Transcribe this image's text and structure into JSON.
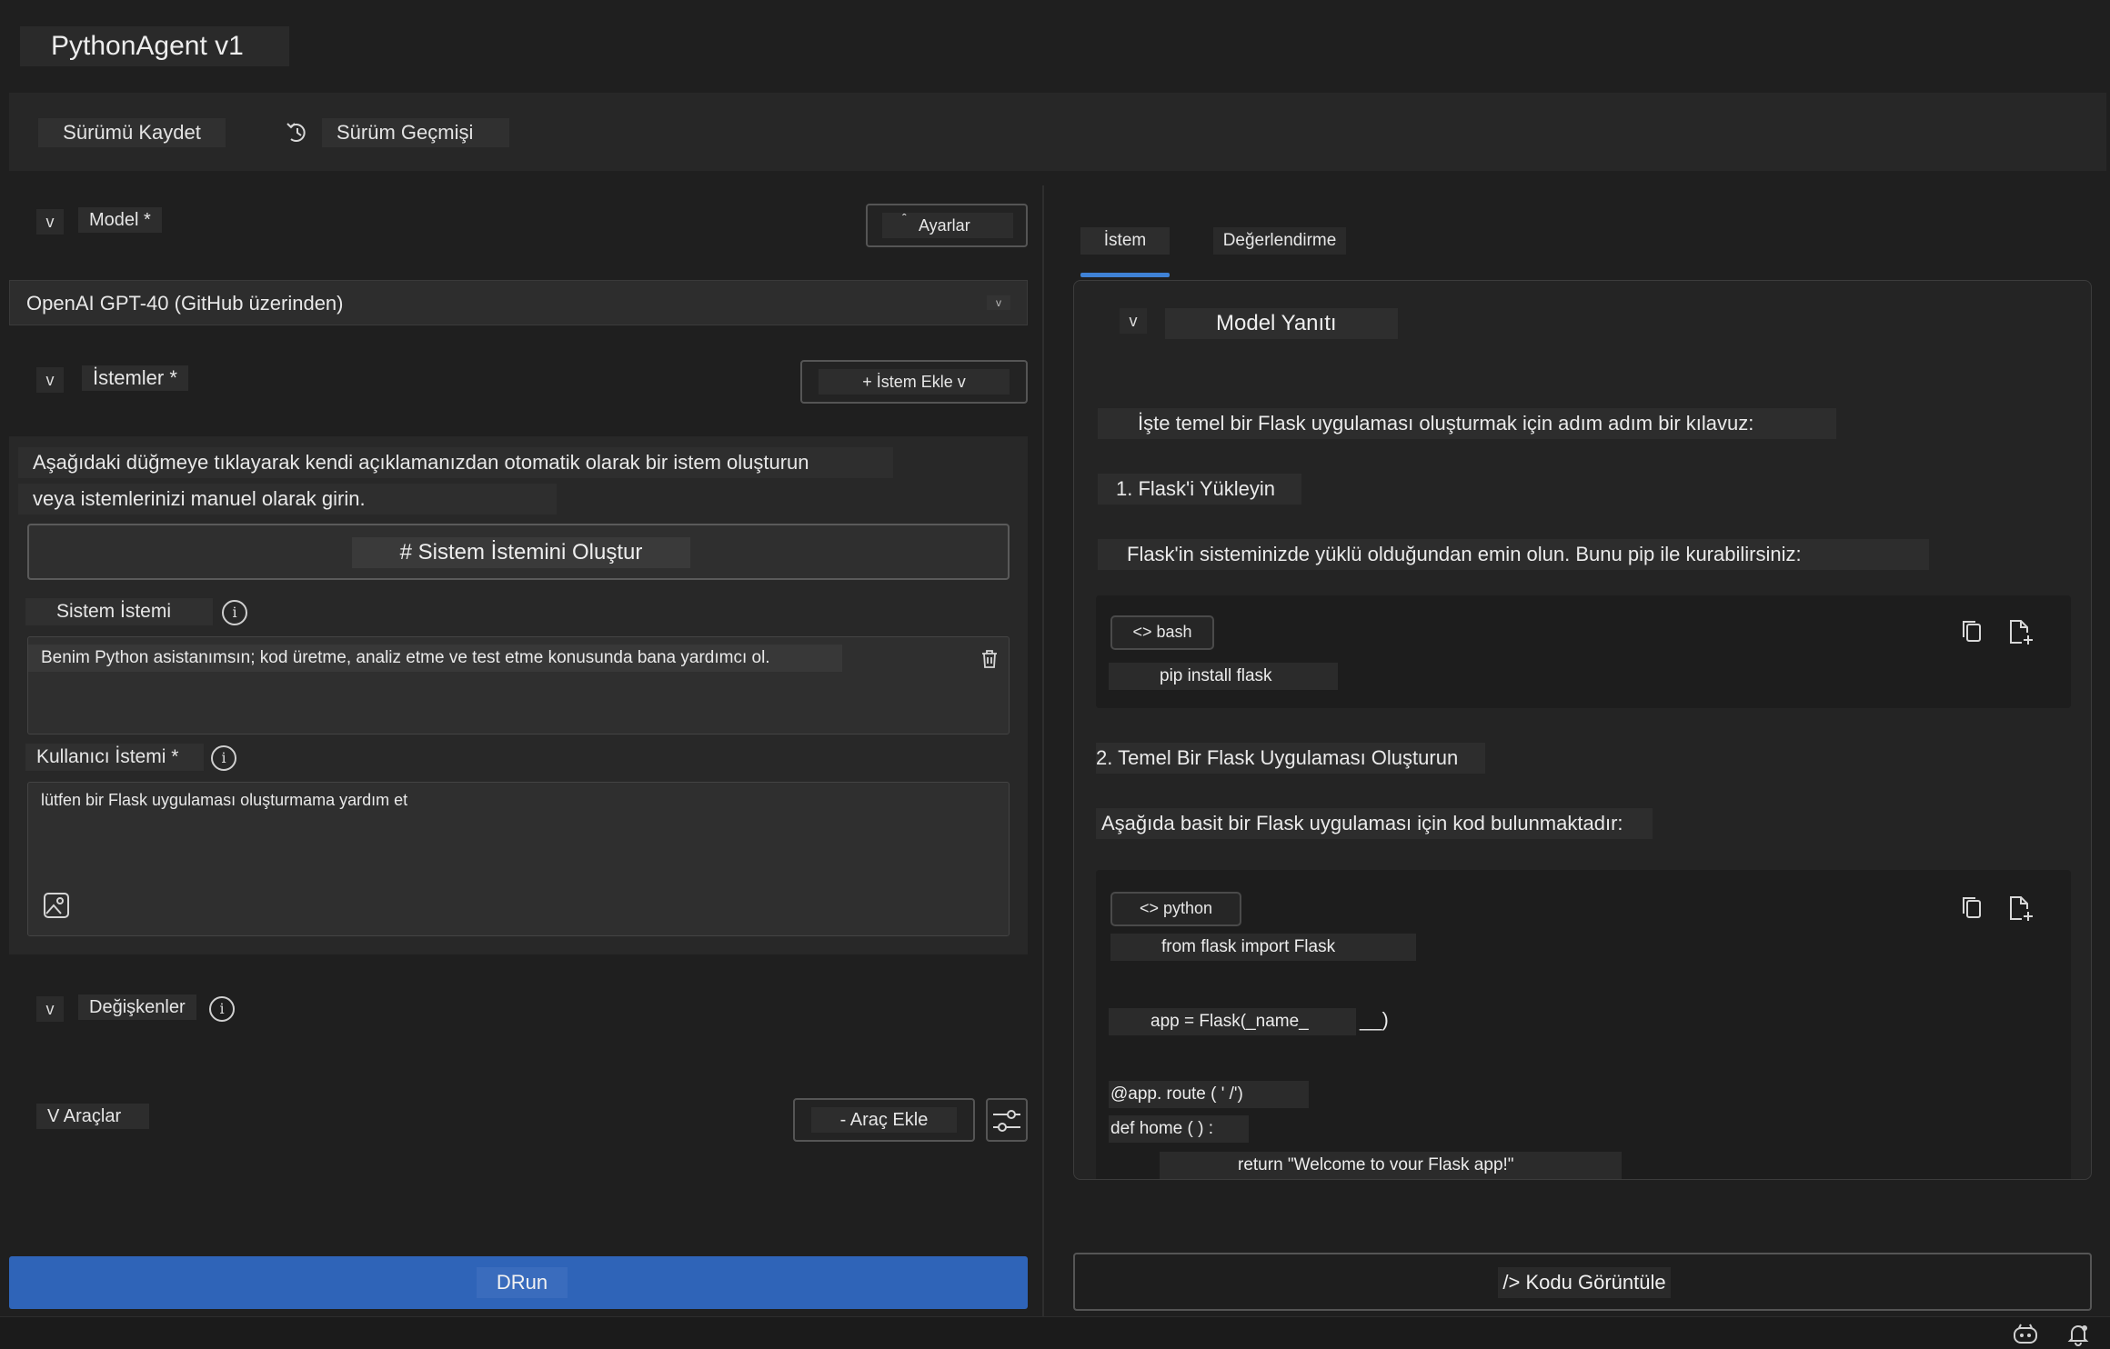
{
  "app": {
    "title": "PythonAgent v1"
  },
  "toolbar": {
    "save_label": "Sürümü Kaydet",
    "history_label": "Sürüm Geçmişi"
  },
  "left": {
    "model_toggle": "v",
    "model_label": "Model *",
    "settings_label": "Ayarlar",
    "model_value": "OpenAI GPT-40 (GitHub üzerinden)",
    "prompts_toggle": "v",
    "prompts_label": "İstemler *",
    "add_prompt_label": "+ İstem Ekle v",
    "description_line1": "Aşağıdaki düğmeye tıklayarak kendi açıklamanızdan otomatik olarak bir istem oluşturun",
    "description_line2": "veya istemlerinizi manuel olarak girin.",
    "generate_label": "# Sistem İstemini Oluştur",
    "system_prompt_label": "Sistem İstemi",
    "system_prompt_value": "Benim Python asistanımsın; kod üretme, analiz etme ve test etme konusunda bana yardımcı ol.",
    "user_prompt_label": "Kullanıcı İstemi *",
    "user_prompt_value": "lütfen bir Flask uygulaması oluşturmama yardım et",
    "variables_toggle": "v",
    "variables_label": "Değişkenler",
    "tools_label": "V Araçlar",
    "add_tool_label": "- Araç Ekle",
    "run_label": "DRun",
    "info_glyph": "i"
  },
  "right": {
    "tabs": [
      {
        "label": "İstem",
        "active": true
      },
      {
        "label": "Değerlendirme",
        "active": false
      }
    ],
    "response_toggle": "v",
    "response_title": "Model Yanıtı",
    "intro": "İşte temel bir Flask uygulaması oluşturmak için adım adım bir kılavuz:",
    "step1": "1. Flask'i Yükleyin",
    "step1_desc": "Flask'in sisteminizde yüklü olduğundan emin olun. Bunu pip ile kurabilirsiniz:",
    "bash_lang": "<> bash",
    "bash_code": "pip install flask",
    "step2": "2. Temel Bir Flask Uygulaması Oluşturun",
    "step2_desc": "Aşağıda basit bir Flask uygulaması için kod bulunmaktadır:",
    "python_lang": "<> python",
    "python_lines": [
      "from flask import Flask",
      "app = Flask(_name_",
      "__)",
      "@app. route ( ' /')",
      "def home ( ) :",
      "return \"Welcome to vour Flask app!\""
    ],
    "view_code_label": "/> Kodu Görüntüle"
  },
  "colors": {
    "accent": "#3f82d6",
    "run_button": "#2f64b8",
    "background": "#1f1f1f"
  }
}
